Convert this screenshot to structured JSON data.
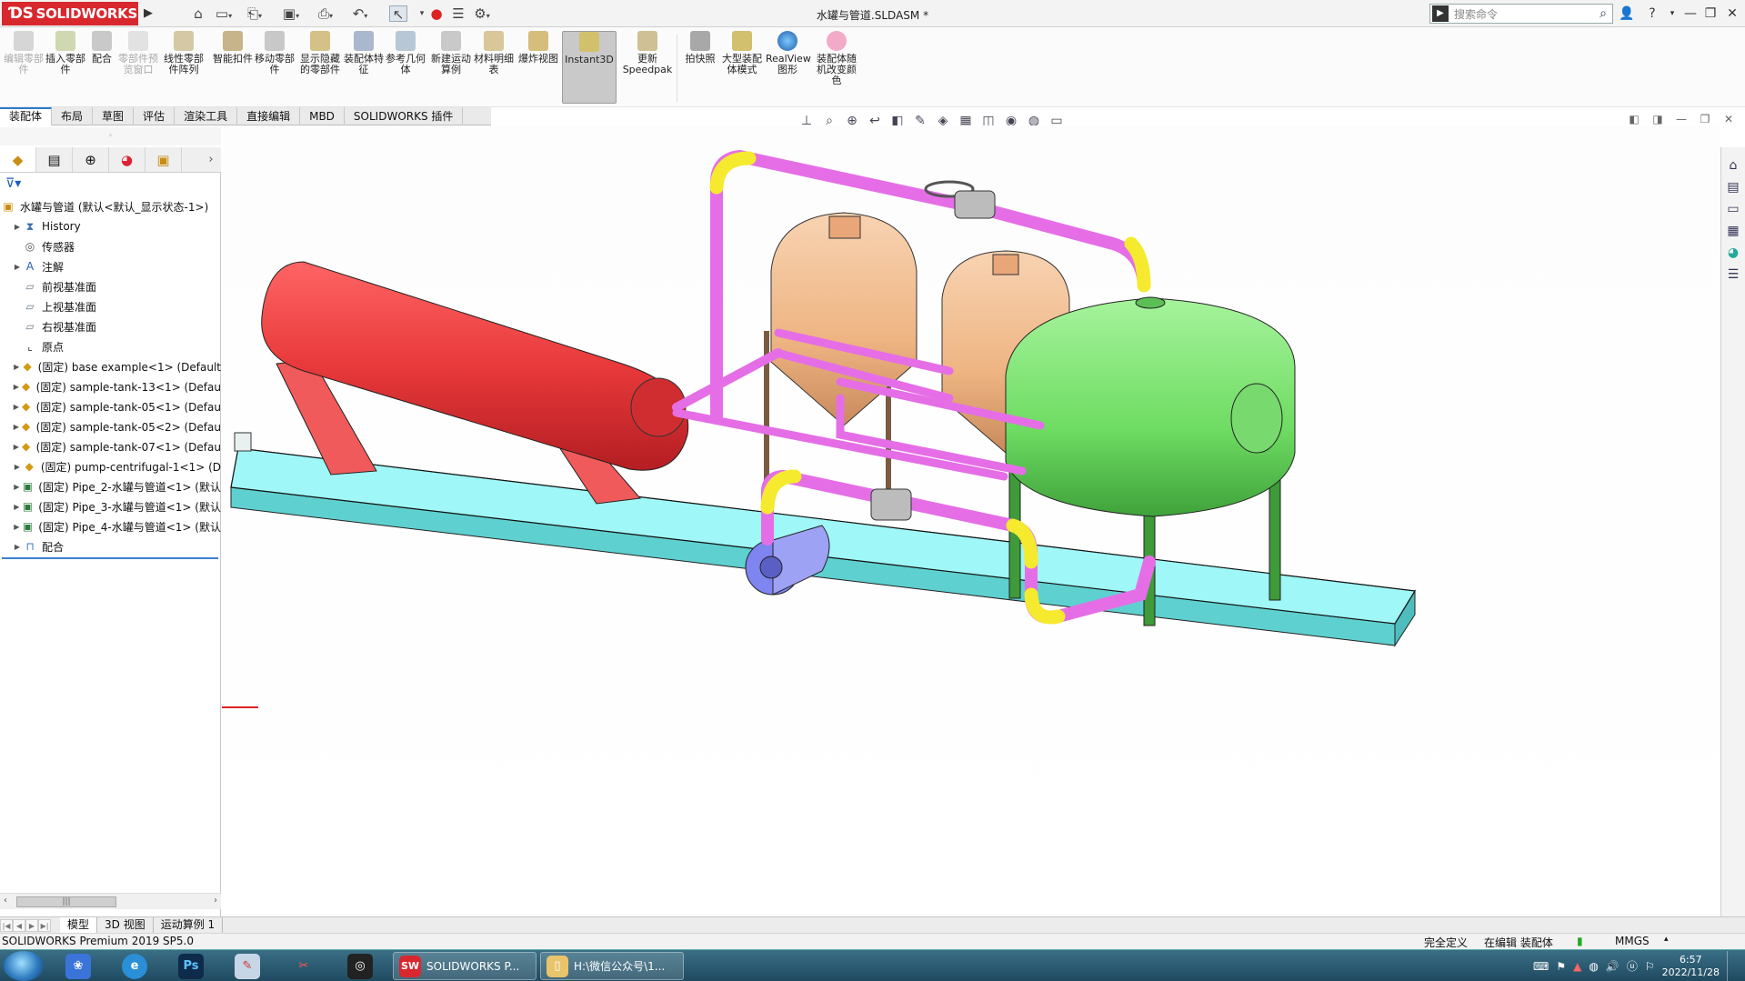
{
  "app": {
    "logo": "SOLIDWORKS",
    "doc_title": "水罐与管道.SLDASM *"
  },
  "search": {
    "placeholder": "搜索命令"
  },
  "ribbon": [
    {
      "label": "编辑零部件",
      "disabled": true
    },
    {
      "label": "插入零部件"
    },
    {
      "label": "配合"
    },
    {
      "label": "零部件预览窗口",
      "disabled": true
    },
    {
      "label": "线性零部件阵列"
    },
    {
      "label": "智能扣件"
    },
    {
      "label": "移动零部件"
    },
    {
      "label": "显示隐藏的零部件"
    },
    {
      "label": "装配体特征"
    },
    {
      "label": "参考几何体"
    },
    {
      "label": "新建运动算例"
    },
    {
      "label": "材料明细表"
    },
    {
      "label": "爆炸视图"
    },
    {
      "label": "Instant3D",
      "active": true
    },
    {
      "label": "更新Speedpak"
    },
    {
      "label": "拍快照"
    },
    {
      "label": "大型装配体模式"
    },
    {
      "label": "RealView图形"
    },
    {
      "label": "装配体随机改变颜色"
    }
  ],
  "cmd_tabs": [
    "装配体",
    "布局",
    "草图",
    "评估",
    "渲染工具",
    "直接编辑",
    "MBD",
    "SOLIDWORKS 插件"
  ],
  "tree": {
    "root": "水罐与管道 (默认<默认_显示状态-1>)",
    "items": [
      {
        "label": "History",
        "expand": true,
        "icon": "history-icon"
      },
      {
        "label": "传感器",
        "expand": false,
        "icon": "sensor-icon"
      },
      {
        "label": "注解",
        "expand": true,
        "icon": "annotation-icon"
      },
      {
        "label": "前视基准面",
        "expand": false,
        "icon": "plane-icon"
      },
      {
        "label": "上视基准面",
        "expand": false,
        "icon": "plane-icon"
      },
      {
        "label": "右视基准面",
        "expand": false,
        "icon": "plane-icon"
      },
      {
        "label": "原点",
        "expand": false,
        "icon": "origin-icon"
      },
      {
        "label": "(固定) base example<1> (Default",
        "expand": true,
        "icon": "part-icon"
      },
      {
        "label": "(固定) sample-tank-13<1> (Defau",
        "expand": true,
        "icon": "part-icon"
      },
      {
        "label": "(固定) sample-tank-05<1> (Defau",
        "expand": true,
        "icon": "part-icon"
      },
      {
        "label": "(固定) sample-tank-05<2> (Defau",
        "expand": true,
        "icon": "part-icon"
      },
      {
        "label": "(固定) sample-tank-07<1> (Defau",
        "expand": true,
        "icon": "part-icon"
      },
      {
        "label": "(固定) pump-centrifugal-1<1> (D",
        "expand": true,
        "icon": "part-icon"
      },
      {
        "label": "(固定) Pipe_2-水罐与管道<1> (默认",
        "expand": true,
        "icon": "subassembly-icon"
      },
      {
        "label": "(固定) Pipe_3-水罐与管道<1> (默认",
        "expand": true,
        "icon": "subassembly-icon"
      },
      {
        "label": "(固定) Pipe_4-水罐与管道<1> (默认",
        "expand": true,
        "icon": "subassembly-icon"
      },
      {
        "label": "配合",
        "expand": true,
        "icon": "mates-icon"
      }
    ]
  },
  "bottom_tabs": [
    "模型",
    "3D 视图",
    "运动算例 1"
  ],
  "status": {
    "version": "SOLIDWORKS Premium 2019 SP5.0",
    "definition": "完全定义",
    "editing": "在编辑 装配体",
    "units": "MMGS"
  },
  "taskbar": {
    "items": [
      "SOLIDWORKS P...",
      "H:\\微信公众号\\1..."
    ],
    "time": "6:57",
    "date": "2022/11/28"
  },
  "colors": {
    "tank_red": "#e8393b",
    "tank_green": "#76e06a",
    "tank_copper": "#f1b98e",
    "base": "#9ff7f7",
    "pipe": "#e56ee6",
    "pipe_fitting": "#f5ea2e",
    "pump": "#7e84f0"
  }
}
